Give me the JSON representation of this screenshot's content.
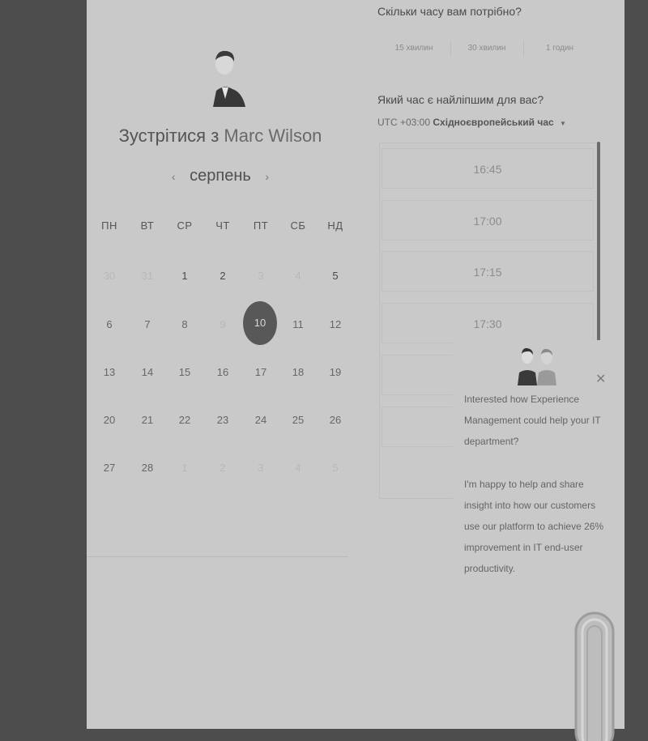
{
  "meeting": {
    "prefix": "Зустрітися з",
    "name": "Marc Wilson"
  },
  "calendar": {
    "month": "серпень",
    "prev_icon": "chevron-left-icon",
    "next_icon": "chevron-right-icon",
    "weekdays": [
      "ПН",
      "ВТ",
      "СР",
      "ЧТ",
      "ПТ",
      "СБ",
      "НД"
    ],
    "weeks": [
      [
        "30",
        "31",
        "1",
        "2",
        "3",
        "4",
        "5"
      ],
      [
        "6",
        "7",
        "8",
        "9",
        "10",
        "11",
        "12"
      ],
      [
        "13",
        "14",
        "15",
        "16",
        "17",
        "18",
        "19"
      ],
      [
        "20",
        "21",
        "22",
        "23",
        "24",
        "25",
        "26"
      ],
      [
        "27",
        "28",
        "1",
        "2",
        "3",
        "4",
        "5"
      ]
    ],
    "selected_day": "10"
  },
  "duration": {
    "question": "Скільки часу вам потрібно?",
    "options": [
      "15 хвилин",
      "30 хвилин",
      "1 годин"
    ]
  },
  "time": {
    "question": "Який час є найліпшим для вас?",
    "tz_offset": "UTC +03:00",
    "tz_name": "Східноєвропейський час",
    "slots": [
      "16:45",
      "17:00",
      "17:15",
      "17:30"
    ]
  },
  "chat": {
    "close_icon": "close-icon",
    "message_1": "Interested how Experience Management could help your IT department?",
    "message_2": "I'm happy to help and share insight into how our customers use our platform to achieve 26% improvement in IT end-user productivity."
  },
  "colors": {
    "background": "#4d4d4d",
    "panel": "#c9c9c9",
    "selected_day": "#585858"
  }
}
